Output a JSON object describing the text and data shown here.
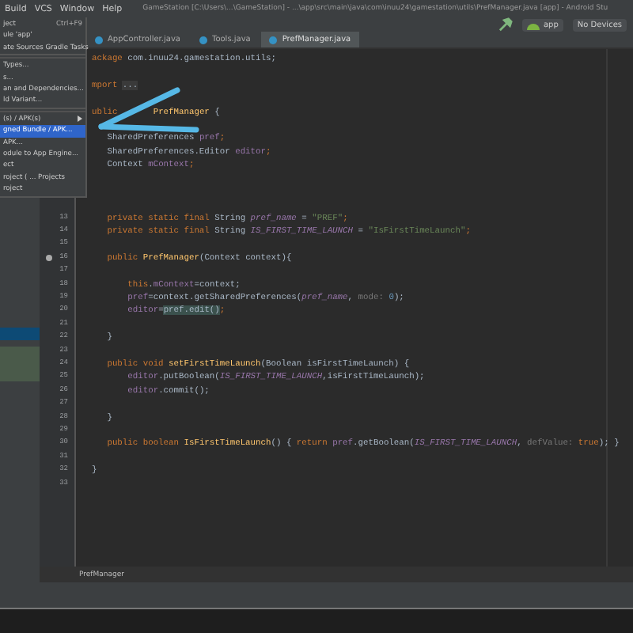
{
  "menu_bar": {
    "items": [
      "Build",
      "VCS",
      "Window",
      "Help"
    ],
    "title": "GameStation [C:\\Users\\...\\GameStation] - ...\\app\\src\\main\\java\\com\\inuu24\\gamestation\\utils\\PrefManager.java [app] - Android Stu"
  },
  "toolbar": {
    "run_config": "app",
    "device": "No Devices"
  },
  "tabs": [
    {
      "label": "AppController.java",
      "selected": false
    },
    {
      "label": "Tools.java",
      "selected": false
    },
    {
      "label": "PrefManager.java",
      "selected": true
    }
  ],
  "build_menu": [
    {
      "label": "ject",
      "shortcut": "Ctrl+F9",
      "selected": false,
      "submenu": false,
      "separator_after": false
    },
    {
      "label": "ule 'app'",
      "selected": false,
      "submenu": false,
      "separator_after": false
    },
    {
      "label": "ate Sources Gradle Tasks",
      "selected": false,
      "submenu": false,
      "separator_after": true
    },
    {
      "label": "Types...",
      "selected": false,
      "submenu": false,
      "separator_after": false
    },
    {
      "label": "s...",
      "selected": false,
      "submenu": false,
      "separator_after": false
    },
    {
      "label": "an and Dependencies...",
      "selected": false,
      "submenu": false,
      "separator_after": false
    },
    {
      "label": "ld Variant...",
      "selected": false,
      "submenu": false,
      "separator_after": true
    },
    {
      "label": "(s) / APK(s)",
      "selected": false,
      "submenu": true,
      "separator_after": false
    },
    {
      "label": "gned Bundle / APK...",
      "selected": true,
      "submenu": false,
      "separator_after": false
    },
    {
      "label": "APK...",
      "selected": false,
      "submenu": false,
      "separator_after": false
    },
    {
      "label": "odule to App Engine...",
      "selected": false,
      "submenu": false,
      "separator_after": false
    },
    {
      "label": "ect",
      "selected": false,
      "submenu": false,
      "separator_after": false
    },
    {
      "label": "roject ( ... Projects",
      "selected": false,
      "submenu": false,
      "separator_after": false
    },
    {
      "label": "roject",
      "selected": false,
      "submenu": false,
      "separator_after": false
    }
  ],
  "project_rows": [
    {
      "selected": true
    },
    {
      "selected": false,
      "highlighted": true
    }
  ],
  "code_lines": [
    {
      "kind": "code",
      "segments": [
        {
          "text": "ackage ",
          "kind": "keyword"
        },
        {
          "text": "com.inuu24.gamestation.utils;",
          "kind": "plain"
        }
      ]
    },
    {
      "kind": "blank"
    },
    {
      "kind": "code",
      "segments": [
        {
          "text": "mport ",
          "kind": "keyword"
        },
        {
          "text": "...",
          "kind": "folded"
        }
      ]
    },
    {
      "kind": "blank"
    },
    {
      "kind": "code",
      "segments": [
        {
          "text": "ublic",
          "kind": "keyword"
        },
        {
          "text": "PrefManager",
          "kind": "declaration",
          "covered_before": true
        },
        {
          "text": " {",
          "kind": "plain"
        }
      ]
    },
    {
      "kind": "blank"
    },
    {
      "kind": "code",
      "segments": [
        {
          "text": "   SharedPreferences ",
          "kind": "plain"
        },
        {
          "text": "pref",
          "kind": "field"
        },
        {
          "text": ";",
          "kind": "keyword"
        }
      ]
    },
    {
      "kind": "code",
      "segments": [
        {
          "text": "   SharedPreferences.Editor ",
          "kind": "plain"
        },
        {
          "text": "editor",
          "kind": "field"
        },
        {
          "text": ";",
          "kind": "keyword"
        }
      ]
    },
    {
      "kind": "code",
      "segments": [
        {
          "text": "   Context ",
          "kind": "plain"
        },
        {
          "text": "mContext",
          "kind": "field"
        },
        {
          "text": ";",
          "kind": "keyword"
        }
      ]
    },
    {
      "kind": "blank"
    },
    {
      "kind": "blank"
    },
    {
      "kind": "blank"
    },
    {
      "kind": "code",
      "number": "13",
      "segments": [
        {
          "text": "   private static final ",
          "kind": "keyword"
        },
        {
          "text": "String ",
          "kind": "plain"
        },
        {
          "text": "pref_name",
          "kind": "constant"
        },
        {
          "text": " = ",
          "kind": "plain"
        },
        {
          "text": "\"PREF\"",
          "kind": "string"
        },
        {
          "text": ";",
          "kind": "keyword"
        }
      ]
    },
    {
      "kind": "code",
      "number": "14",
      "segments": [
        {
          "text": "   private static final ",
          "kind": "keyword"
        },
        {
          "text": "String ",
          "kind": "plain"
        },
        {
          "text": "IS_FIRST_TIME_LAUNCH",
          "kind": "constant"
        },
        {
          "text": " = ",
          "kind": "plain"
        },
        {
          "text": "\"IsFirstTimeLaunch\"",
          "kind": "string"
        },
        {
          "text": ";",
          "kind": "keyword"
        }
      ]
    },
    {
      "kind": "blank",
      "number": "15"
    },
    {
      "kind": "code",
      "number": "16",
      "gutter_icon": true,
      "segments": [
        {
          "text": "   public ",
          "kind": "keyword"
        },
        {
          "text": "PrefManager",
          "kind": "declaration"
        },
        {
          "text": "(Context context){",
          "kind": "plain"
        }
      ]
    },
    {
      "kind": "blank",
      "number": "17"
    },
    {
      "kind": "code",
      "number": "18",
      "segments": [
        {
          "text": "       this",
          "kind": "keyword"
        },
        {
          "text": ".",
          "kind": "plain"
        },
        {
          "text": "mContext",
          "kind": "field"
        },
        {
          "text": "=context;",
          "kind": "plain"
        }
      ]
    },
    {
      "kind": "code",
      "number": "19",
      "segments": [
        {
          "text": "       pref",
          "kind": "field"
        },
        {
          "text": "=context.getSharedPreferences(",
          "kind": "plain"
        },
        {
          "text": "pref_name",
          "kind": "constant"
        },
        {
          "text": ", ",
          "kind": "plain"
        },
        {
          "text": "mode: ",
          "kind": "hint"
        },
        {
          "text": "0",
          "kind": "number"
        },
        {
          "text": ");",
          "kind": "plain"
        }
      ]
    },
    {
      "kind": "code",
      "number": "20",
      "segments": [
        {
          "text": "       editor",
          "kind": "field"
        },
        {
          "text": "=",
          "kind": "plain"
        },
        {
          "text": "pref.edit()",
          "kind": "match"
        },
        {
          "text": ";",
          "kind": "keyword"
        }
      ]
    },
    {
      "kind": "blank",
      "number": "21"
    },
    {
      "kind": "code",
      "number": "22",
      "segments": [
        {
          "text": "   }",
          "kind": "plain"
        }
      ]
    },
    {
      "kind": "blank",
      "number": "23"
    },
    {
      "kind": "code",
      "number": "24",
      "segments": [
        {
          "text": "   public void ",
          "kind": "keyword"
        },
        {
          "text": "setFirstTimeLaunch",
          "kind": "declaration"
        },
        {
          "text": "(Boolean isFirstTimeLaunch) {",
          "kind": "plain"
        }
      ]
    },
    {
      "kind": "code",
      "number": "25",
      "segments": [
        {
          "text": "       editor",
          "kind": "field"
        },
        {
          "text": ".putBoolean(",
          "kind": "plain"
        },
        {
          "text": "IS_FIRST_TIME_LAUNCH",
          "kind": "constant"
        },
        {
          "text": ",isFirstTimeLaunch);",
          "kind": "plain"
        }
      ]
    },
    {
      "kind": "code",
      "number": "26",
      "segments": [
        {
          "text": "       editor",
          "kind": "field"
        },
        {
          "text": ".commit();",
          "kind": "plain"
        }
      ]
    },
    {
      "kind": "blank",
      "number": "27"
    },
    {
      "kind": "code",
      "number": "28",
      "segments": [
        {
          "text": "   }",
          "kind": "plain"
        }
      ]
    },
    {
      "kind": "blank",
      "number": "29"
    },
    {
      "kind": "code",
      "number": "30",
      "segments": [
        {
          "text": "   public boolean ",
          "kind": "keyword"
        },
        {
          "text": "IsFirstTimeLaunch",
          "kind": "declaration"
        },
        {
          "text": "() { ",
          "kind": "plain"
        },
        {
          "text": "return ",
          "kind": "keyword"
        },
        {
          "text": "pref",
          "kind": "field"
        },
        {
          "text": ".getBoolean(",
          "kind": "plain"
        },
        {
          "text": "IS_FIRST_TIME_LAUNCH",
          "kind": "constant"
        },
        {
          "text": ", ",
          "kind": "plain"
        },
        {
          "text": "defValue: ",
          "kind": "hint"
        },
        {
          "text": "true",
          "kind": "keyword"
        },
        {
          "text": "); }",
          "kind": "plain"
        }
      ]
    },
    {
      "kind": "blank",
      "number": "31"
    },
    {
      "kind": "code",
      "number": "32",
      "segments": [
        {
          "text": "}",
          "kind": "plain"
        }
      ]
    },
    {
      "kind": "blank",
      "number": "33"
    }
  ],
  "breadcrumb": "PrefManager"
}
